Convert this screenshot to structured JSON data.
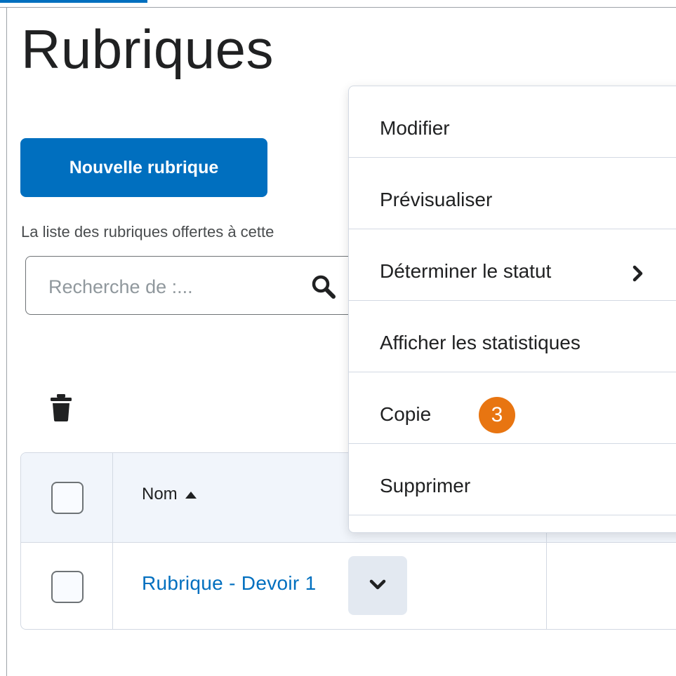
{
  "page": {
    "title": "Rubriques",
    "new_button_label": "Nouvelle rubrique",
    "description": "La liste des rubriques offertes à cette"
  },
  "search": {
    "placeholder": "Recherche de :...",
    "value": "",
    "icon": "search-icon"
  },
  "toolbar": {
    "delete_icon": "trash-icon"
  },
  "table": {
    "headers": {
      "name": "Nom",
      "sort_icon": "caret-up-icon"
    },
    "rows": [
      {
        "name": "Rubrique - Devoir 1",
        "action_icon": "chevron-down-icon"
      }
    ]
  },
  "context_menu": {
    "items": [
      {
        "label": "Modifier"
      },
      {
        "label": "Prévisualiser"
      },
      {
        "label": "Déterminer le statut",
        "has_submenu": true,
        "icon": "chevron-right-icon"
      },
      {
        "label": "Afficher les statistiques"
      },
      {
        "label": "Copie"
      },
      {
        "label": "Supprimer"
      }
    ]
  },
  "callout": {
    "number": "3",
    "color": "#e87511"
  },
  "colors": {
    "accent": "#006fbf",
    "callout": "#e87511",
    "chevron_bg": "#e3e9f1"
  }
}
